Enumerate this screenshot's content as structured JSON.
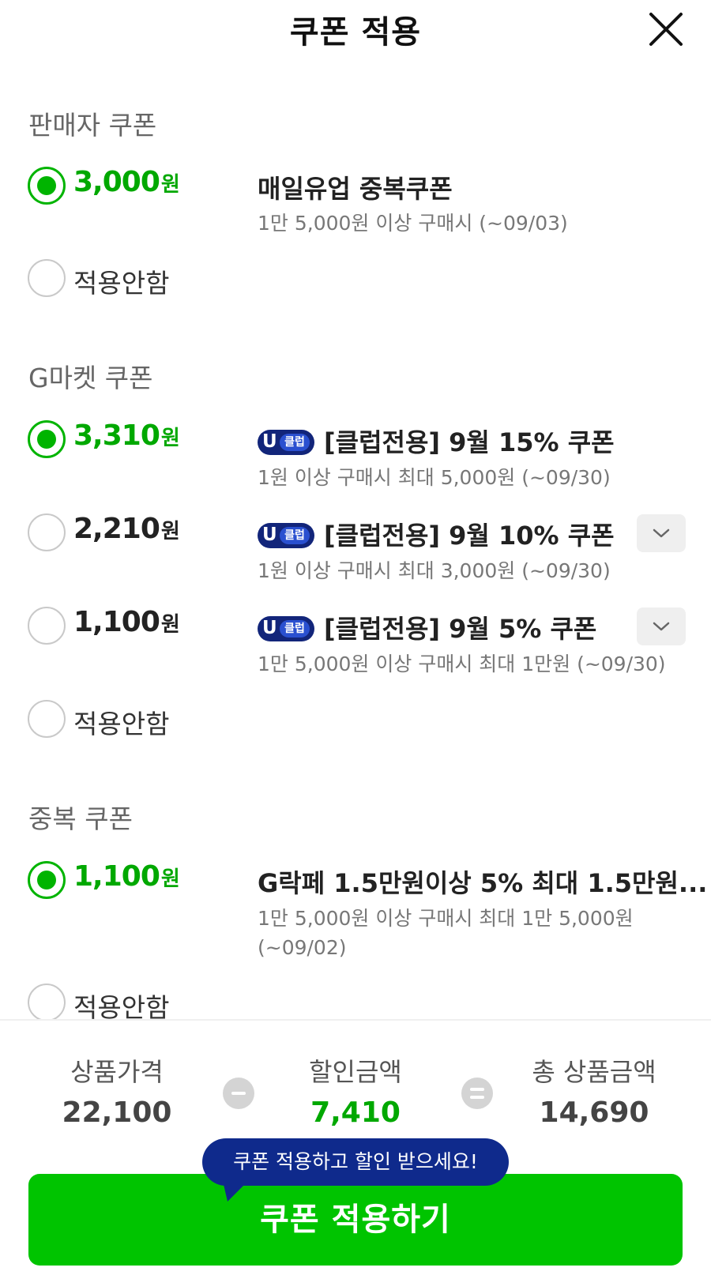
{
  "header": {
    "title": "쿠폰 적용",
    "close_icon": "close-icon"
  },
  "seller_section": {
    "title": "판매자 쿠폰",
    "options": [
      {
        "amount": "3,000",
        "unit": "원",
        "selected": true,
        "name": "매일유업 중복쿠폰",
        "condition": "1만 5,000원 이상 구매시 (~09/03)"
      }
    ],
    "none_label": "적용안함"
  },
  "gmarket_section": {
    "title": "G마켓 쿠폰",
    "badge_u": "U",
    "badge_club": "클럽",
    "options": [
      {
        "amount": "3,310",
        "unit": "원",
        "selected": true,
        "name": "[클럽전용] 9월 15% 쿠폰",
        "condition": "1원 이상 구매시 최대 5,000원 (~09/30)",
        "expandable": false
      },
      {
        "amount": "2,210",
        "unit": "원",
        "selected": false,
        "name": "[클럽전용] 9월 10% 쿠폰",
        "condition": "1원 이상 구매시 최대 3,000원 (~09/30)",
        "expandable": true
      },
      {
        "amount": "1,100",
        "unit": "원",
        "selected": false,
        "name": "[클럽전용] 9월 5% 쿠폰",
        "condition": "1만 5,000원 이상 구매시 최대 1만원 (~09/30)",
        "expandable": true
      }
    ],
    "none_label": "적용안함"
  },
  "duplicate_section": {
    "title": "중복 쿠폰",
    "options": [
      {
        "amount": "1,100",
        "unit": "원",
        "selected": true,
        "name": "G락페 1.5만원이상 5% 최대 1.5만원...",
        "condition_line1": "1만 5,000원 이상 구매시 최대 1만 5,000원",
        "condition_line2": "(~09/02)"
      }
    ],
    "none_label": "적용안함"
  },
  "summary": {
    "price_label": "상품가격",
    "price_value": "22,100",
    "discount_label": "할인금액",
    "discount_value": "7,410",
    "total_label": "총 상품금액",
    "total_value": "14,690"
  },
  "tooltip": "쿠폰 적용하고 할인 받으세요!",
  "apply_button": "쿠폰 적용하기",
  "colors": {
    "accent": "#00c400",
    "selected_text": "#00a800",
    "tooltip_bg": "#0f2a8c",
    "badge_bg": "#12257a"
  }
}
